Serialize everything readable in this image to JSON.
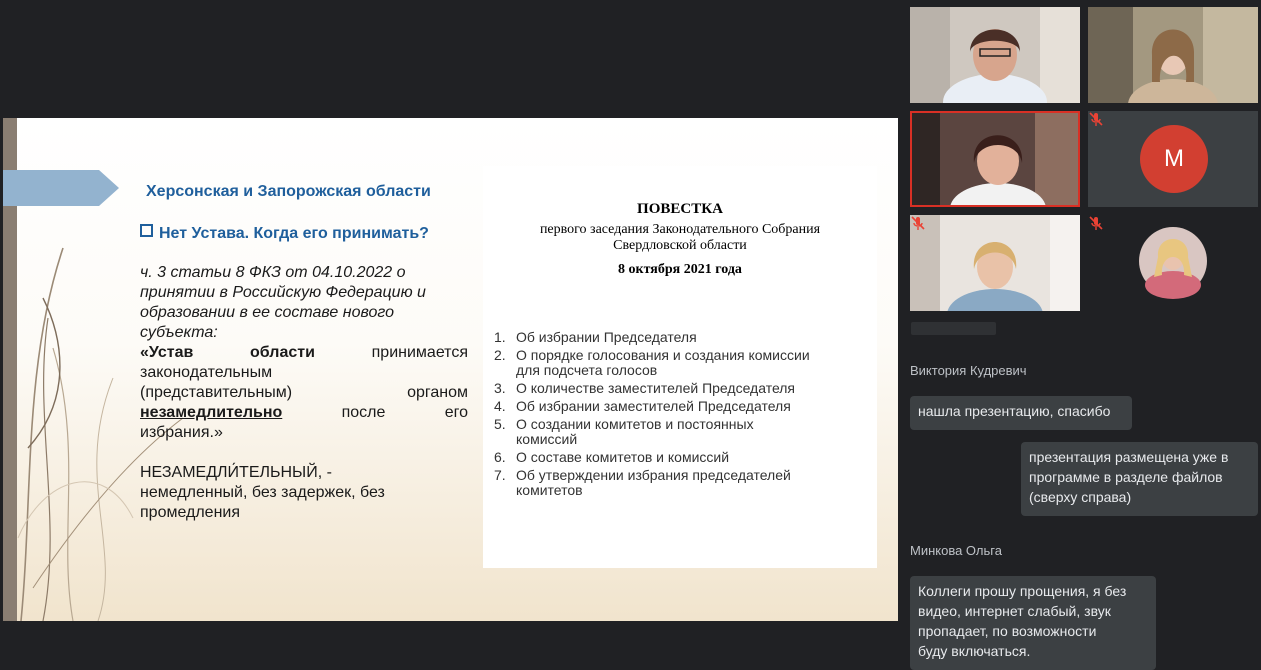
{
  "slide": {
    "title": "Херсонская и Запорожская области",
    "question": "Нет Устава. Когда его принимать?",
    "citation_lines": [
      "ч. 3 статьи 8 ФКЗ от 04.10.2022  о",
      "принятии в Российскую Федерацию и",
      "образовании в ее составе нового",
      "субъекта:"
    ],
    "quote": {
      "l1_a": "«Устав",
      "l1_b": "области",
      "l1_c": "принимается",
      "l2": "законодательным",
      "l3_a": "(представительным)",
      "l3_b": "органом",
      "l4_a": "незамедлительно",
      "l4_b": "после",
      "l4_c": "его",
      "l5": "избрания.»"
    },
    "definition_lines": [
      "НЕЗАМЕДЛИ́ТЕЛЬНЫЙ, -",
      "немедленный, без задержек, без",
      "промедления"
    ],
    "document": {
      "heading": "ПОВЕСТКА",
      "subheading_1": "первого заседания Законодательного Собрания",
      "subheading_2": "Свердловской области",
      "date": "8 октября 2021 года",
      "items": [
        {
          "n": "1.",
          "lines": [
            "Об избрании Председателя"
          ]
        },
        {
          "n": "2.",
          "lines": [
            "О порядке голосования и создания комиссии",
            "для подсчета голосов"
          ]
        },
        {
          "n": "3.",
          "lines": [
            "О количестве заместителей Председателя"
          ]
        },
        {
          "n": "4.",
          "lines": [
            "Об избрании заместителей Председателя"
          ]
        },
        {
          "n": "5.",
          "lines": [
            "О создании комитетов и постоянных",
            "комиссий"
          ]
        },
        {
          "n": "6.",
          "lines": [
            "О составе комитетов и комиссий"
          ]
        },
        {
          "n": "7.",
          "lines": [
            "Об утверждении избрания председателей",
            "комитетов"
          ]
        }
      ]
    }
  },
  "participants": {
    "tile4": {
      "initial": "M",
      "muted": true,
      "avatar_color": "#d23f31"
    },
    "tile4_muted_icon": "mic-off-icon",
    "tile5_muted_icon": "mic-off-icon",
    "tile6_muted_icon": "mic-off-icon",
    "active_speaker_color": "#d93025"
  },
  "chat": {
    "messages": [
      {
        "author": "Виктория Кудревич",
        "lines": [
          "нашла презентацию, спасибо"
        ]
      },
      {
        "author": "",
        "lines": [
          "презентация размещена уже в",
          "программе в разделе файлов",
          "(сверху справа)"
        ]
      },
      {
        "author": "Минкова Ольга",
        "lines": [
          "Коллеги прошу прощения, я без",
          "видео, интернет слабый, звук",
          "пропадает, по возможности",
          "буду включаться."
        ]
      }
    ]
  }
}
